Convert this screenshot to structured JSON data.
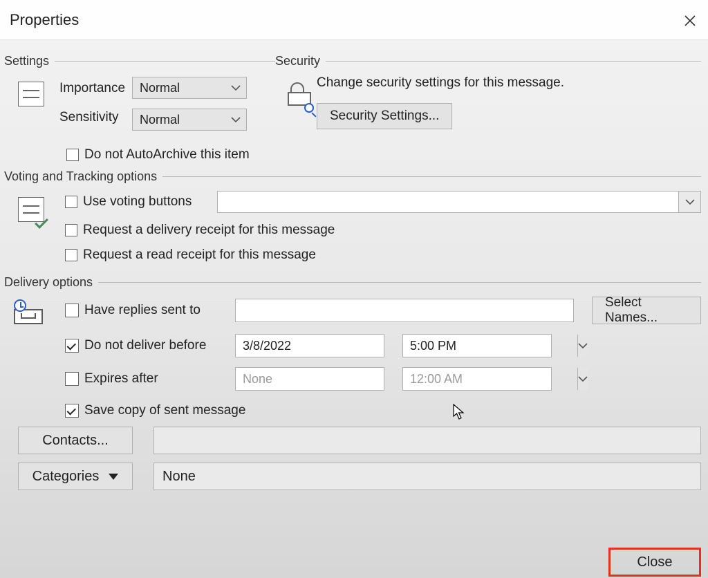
{
  "title": "Properties",
  "groups": {
    "settings": "Settings",
    "security": "Security",
    "voting": "Voting and Tracking options",
    "delivery": "Delivery options"
  },
  "settings": {
    "importance_label": "Importance",
    "importance_value": "Normal",
    "sensitivity_label": "Sensitivity",
    "sensitivity_value": "Normal",
    "autoarchive_label": "Do not AutoArchive this item"
  },
  "security": {
    "text": "Change security settings for this message.",
    "button": "Security Settings..."
  },
  "voting": {
    "use_voting_label": "Use voting buttons",
    "voting_value": "",
    "delivery_receipt_label": "Request a delivery receipt for this message",
    "read_receipt_label": "Request a read receipt for this message"
  },
  "delivery": {
    "replies_label": "Have replies sent to",
    "replies_value": "",
    "select_names_btn": "Select Names...",
    "not_before_label": "Do not deliver before",
    "not_before_date": "3/8/2022",
    "not_before_time": "5:00 PM",
    "expires_label": "Expires after",
    "expires_date": "None",
    "expires_time": "12:00 AM",
    "save_copy_label": "Save copy of sent message"
  },
  "footer": {
    "contacts_btn": "Contacts...",
    "contacts_value": "",
    "categories_btn": "Categories",
    "categories_value": "None",
    "close_btn": "Close"
  }
}
